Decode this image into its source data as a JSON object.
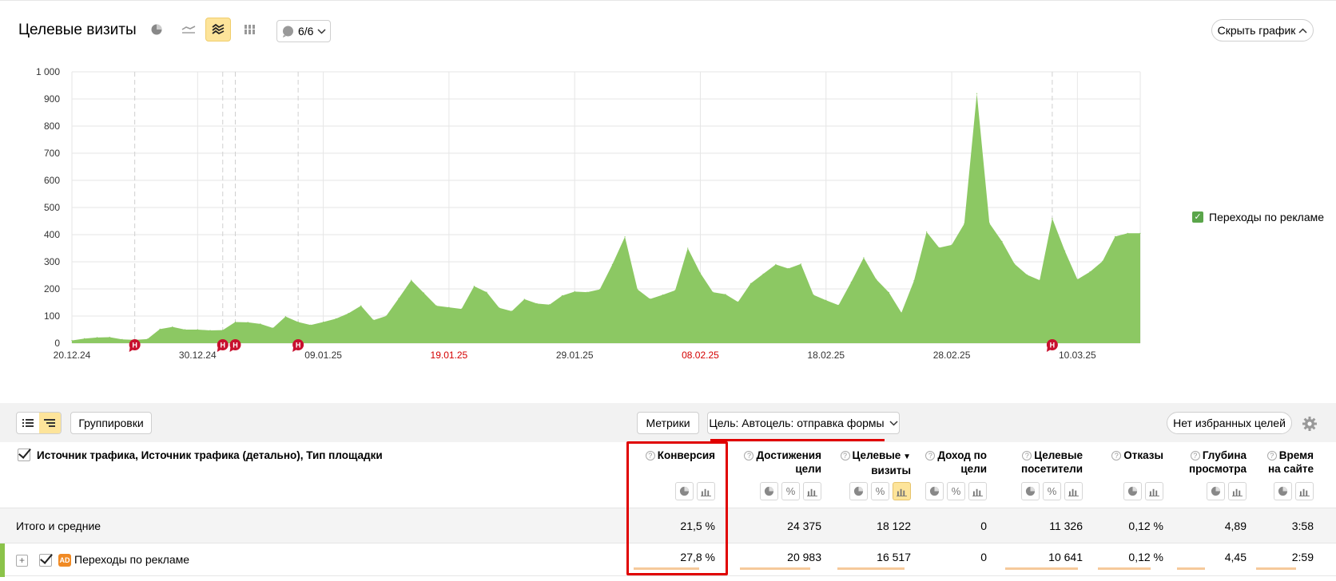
{
  "header": {
    "title": "Целевые визиты",
    "annotations_count": "6/6",
    "hide_chart_label": "Скрыть график"
  },
  "chart_data": {
    "type": "area",
    "title": "",
    "xlabel": "",
    "ylabel": "",
    "ylim": [
      0,
      1000
    ],
    "yticks": [
      "0",
      "100",
      "200",
      "300",
      "400",
      "500",
      "600",
      "700",
      "800",
      "900",
      "1 000"
    ],
    "xticks": [
      {
        "label": "20.12.24",
        "holiday": false
      },
      {
        "label": "30.12.24",
        "holiday": false
      },
      {
        "label": "09.01.25",
        "holiday": false
      },
      {
        "label": "19.01.25",
        "holiday": true
      },
      {
        "label": "29.01.25",
        "holiday": false
      },
      {
        "label": "08.02.25",
        "holiday": true
      },
      {
        "label": "18.02.25",
        "holiday": false
      },
      {
        "label": "28.02.25",
        "holiday": false
      },
      {
        "label": "10.03.25",
        "holiday": false
      }
    ],
    "x_start": "2024-12-20",
    "x_end": "2025-03-15",
    "annotations": [
      "2024-12-25",
      "2025-01-01",
      "2025-01-02",
      "2025-01-07",
      "2025-03-08"
    ],
    "annotation_marker": "Н",
    "series": [
      {
        "name": "Переходы по рекламе",
        "color": "#8cc863",
        "x": [
          "2024-12-20",
          "2024-12-21",
          "2024-12-22",
          "2024-12-23",
          "2024-12-24",
          "2024-12-25",
          "2024-12-26",
          "2024-12-27",
          "2024-12-28",
          "2024-12-29",
          "2024-12-30",
          "2024-12-31",
          "2025-01-01",
          "2025-01-02",
          "2025-01-03",
          "2025-01-04",
          "2025-01-05",
          "2025-01-06",
          "2025-01-07",
          "2025-01-08",
          "2025-01-09",
          "2025-01-10",
          "2025-01-11",
          "2025-01-12",
          "2025-01-13",
          "2025-01-14",
          "2025-01-15",
          "2025-01-16",
          "2025-01-17",
          "2025-01-18",
          "2025-01-19",
          "2025-01-20",
          "2025-01-21",
          "2025-01-22",
          "2025-01-23",
          "2025-01-24",
          "2025-01-25",
          "2025-01-26",
          "2025-01-27",
          "2025-01-28",
          "2025-01-29",
          "2025-01-30",
          "2025-01-31",
          "2025-02-01",
          "2025-02-02",
          "2025-02-03",
          "2025-02-04",
          "2025-02-05",
          "2025-02-06",
          "2025-02-07",
          "2025-02-08",
          "2025-02-09",
          "2025-02-10",
          "2025-02-11",
          "2025-02-12",
          "2025-02-13",
          "2025-02-14",
          "2025-02-15",
          "2025-02-16",
          "2025-02-17",
          "2025-02-18",
          "2025-02-19",
          "2025-02-20",
          "2025-02-21",
          "2025-02-22",
          "2025-02-23",
          "2025-02-24",
          "2025-02-25",
          "2025-02-26",
          "2025-02-27",
          "2025-02-28",
          "2025-03-01",
          "2025-03-02",
          "2025-03-03",
          "2025-03-04",
          "2025-03-05",
          "2025-03-06",
          "2025-03-07",
          "2025-03-08",
          "2025-03-09",
          "2025-03-10",
          "2025-03-11",
          "2025-03-12",
          "2025-03-13",
          "2025-03-14",
          "2025-03-15"
        ],
        "values": [
          10,
          17,
          21,
          22,
          14,
          12,
          15,
          52,
          60,
          50,
          50,
          47,
          48,
          78,
          77,
          71,
          56,
          98,
          78,
          67,
          78,
          90,
          110,
          138,
          85,
          100,
          165,
          232,
          185,
          138,
          132,
          126,
          210,
          188,
          130,
          118,
          162,
          146,
          142,
          175,
          190,
          188,
          198,
          290,
          392,
          198,
          163,
          178,
          195,
          350,
          258,
          188,
          180,
          152,
          220,
          255,
          290,
          275,
          292,
          178,
          158,
          140,
          225,
          315,
          235,
          187,
          112,
          230,
          410,
          352,
          362,
          440,
          920,
          442,
          375,
          292,
          252,
          232,
          460,
          340,
          235,
          263,
          302,
          393,
          405,
          405
        ]
      }
    ],
    "legend": {
      "label": "Переходы по рекламе",
      "position": "right"
    }
  },
  "toolbar": {
    "groupings_label": "Группировки",
    "metrics_label": "Метрики",
    "goal_label": "Цель: Автоцель: отправка формы",
    "favorites_label": "Нет избранных целей"
  },
  "table": {
    "dimension_header": "Источник трафика, Источник трафика (детально), Тип площадки",
    "columns": [
      {
        "line1": "Конверсия",
        "line2": ""
      },
      {
        "line1": "Достижения",
        "line2": "цели"
      },
      {
        "line1": "Целевые",
        "line2": "визиты"
      },
      {
        "line1": "Доход по",
        "line2": "цели"
      },
      {
        "line1": "Целевые",
        "line2": "посетители"
      },
      {
        "line1": "Отказы",
        "line2": ""
      },
      {
        "line1": "Глубина",
        "line2": "просмотра"
      },
      {
        "line1": "Время",
        "line2": "на сайте"
      }
    ],
    "sort_marker": "▼",
    "total": {
      "label": "Итого и средние",
      "values": [
        "21,5 %",
        "24 375",
        "18 122",
        "0",
        "11 326",
        "0,12 %",
        "4,89",
        "3:58"
      ]
    },
    "rows": [
      {
        "ad_badge": "AD",
        "label": "Переходы по рекламе",
        "values": [
          "27,8 %",
          "20 983",
          "16 517",
          "0",
          "10 641",
          "0,12 %",
          "4,45",
          "2:59"
        ],
        "bar_fractions": [
          0.8,
          0.86,
          0.91,
          0,
          0.94,
          0.8,
          0.4,
          0.7
        ]
      }
    ]
  }
}
